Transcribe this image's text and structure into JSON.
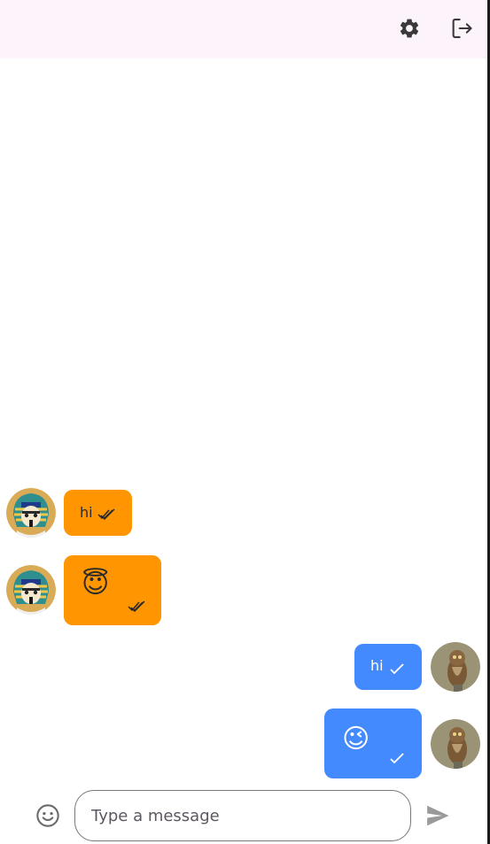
{
  "composer": {
    "placeholder": "Type a message"
  },
  "messages": [
    {
      "direction": "incoming",
      "type": "text",
      "text": "hi",
      "status": "read",
      "avatar": "pharaoh-avatar"
    },
    {
      "direction": "incoming",
      "type": "emoji",
      "text": "😇",
      "status": "read",
      "avatar": "pharaoh-avatar"
    },
    {
      "direction": "outgoing",
      "type": "text",
      "text": "hi",
      "status": "sent",
      "avatar": "owl-avatar"
    },
    {
      "direction": "outgoing",
      "type": "emoji",
      "text": "😉",
      "status": "sent",
      "avatar": "owl-avatar"
    }
  ],
  "icons": {
    "appbar": [
      "gear-icon",
      "logout-icon"
    ],
    "composer": [
      "emoji-icon",
      "send-icon"
    ]
  },
  "colors": {
    "appbar_bg": "#fdf3fb",
    "incoming_bubble": "#ff9500",
    "outgoing_bubble": "#448aff",
    "icon_dark": "#3a3a3a"
  }
}
